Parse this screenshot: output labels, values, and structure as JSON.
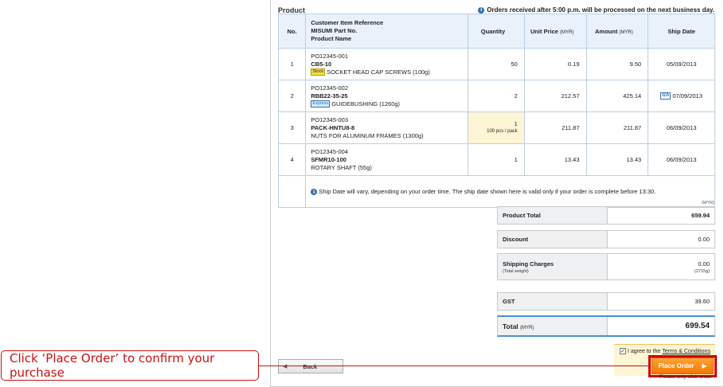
{
  "product": {
    "title": "Product",
    "notice": "Orders received after 5:00 p.m. will be processed on the next business day.",
    "headers": {
      "no": "No.",
      "desc_line1": "Customer Item Reference",
      "desc_line2": "MISUMI Part No.",
      "desc_line3": "Product Name",
      "quantity": "Quantity",
      "unit_price": "Unit Price",
      "unit_price_unit": "(MYR)",
      "amount": "Amount",
      "amount_unit": "(MYR)",
      "ship_date": "Ship Date"
    },
    "rows": [
      {
        "no": "1",
        "ref": "PO12345-001",
        "part": "CB5-10",
        "tag": "Stock",
        "name": "SOCKET HEAD CAP SCREWS (100g)",
        "qty": "50",
        "qty_sub": "",
        "price": "0.19",
        "amount": "9.50",
        "ship_tag": "",
        "ship": "05/09/2013"
      },
      {
        "no": "2",
        "ref": "PO12345-002",
        "part": "RBB22-35-25",
        "tag": "Express",
        "name": "GUIDEBUSHING (1260g)",
        "qty": "2",
        "qty_sub": "",
        "price": "212.57",
        "amount": "425.14",
        "ship_tag": "IzA",
        "ship": "07/09/2013"
      },
      {
        "no": "3",
        "ref": "PO12345-003",
        "part": "PACK-HNTU8-8",
        "tag": "",
        "name": "NUTS FOR ALUMINUM FRAMES (1300g)",
        "qty": "1",
        "qty_sub": "100 pcs / pack",
        "price": "211.87",
        "amount": "211.87",
        "ship_tag": "",
        "ship": "06/09/2013"
      },
      {
        "no": "4",
        "ref": "PO12345-004",
        "part": "SFMR10-100",
        "tag": "",
        "name": "ROTARY SHAFT (55g)",
        "qty": "1",
        "qty_sub": "",
        "price": "13.43",
        "amount": "13.43",
        "ship_tag": "",
        "ship": "06/09/2013"
      }
    ],
    "ship_note": "Ship Date will vary, depending on your order time. The ship date shown here is valid only if your order is complete before 13:30."
  },
  "summary": {
    "currency": "(MYR)",
    "product_total_label": "Product Total",
    "product_total": "659.94",
    "discount_label": "Discount",
    "discount": "0.00",
    "shipping_label": "Shipping Charges",
    "shipping_sub_label": "(Total weight)",
    "shipping": "0.00",
    "weight": "(2715g)",
    "gst_label": "GST",
    "gst": "39.60",
    "total_label": "Total",
    "total_unit": "(MYR)",
    "total": "699.54"
  },
  "footer": {
    "agree_text": "I agree to the",
    "terms_link": "Terms & Conditions",
    "back_label": "Back",
    "place_order_label": "Place Order",
    "place_note": "Please only click once."
  },
  "callout": {
    "text": "Click ‘Place Order’ to confirm your purchase"
  },
  "colors": {
    "accent_orange": "#f57900",
    "highlight_red": "#cc0000",
    "header_blue": "#e9f2fb"
  }
}
